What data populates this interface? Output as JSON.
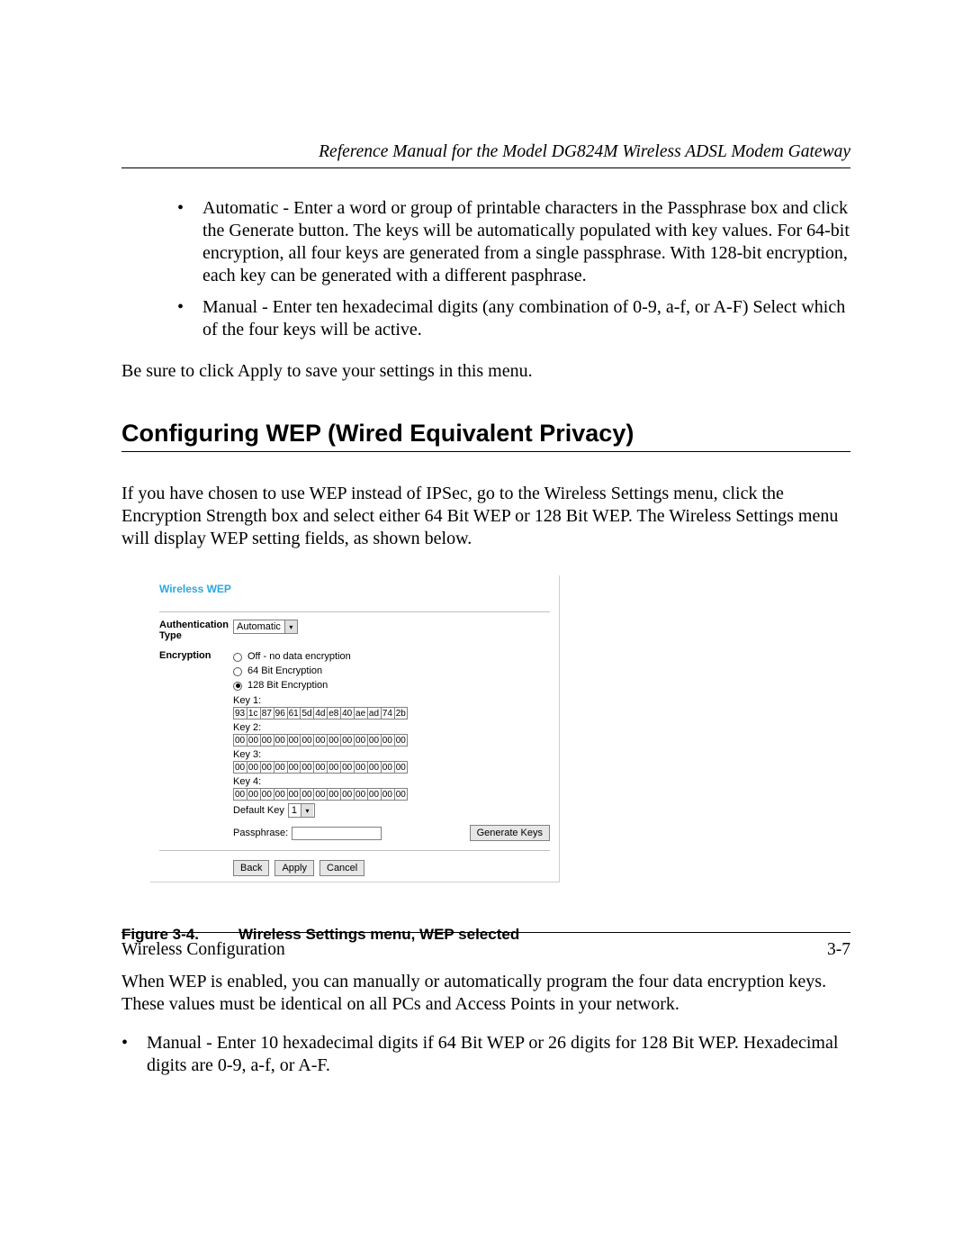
{
  "header": {
    "running_head": "Reference Manual for the Model DG824M Wireless ADSL Modem Gateway"
  },
  "bullets": {
    "automatic": "Automatic - Enter a word or group of printable characters in the Passphrase box and click the Generate button. The keys will be automatically populated with key values. For 64-bit encryption, all four keys are generated from a single passphrase. With 128-bit encryption, each key can be generated with a different pasphrase.",
    "manual_top": "Manual - Enter ten hexadecimal digits (any combination of 0-9, a-f, or A-F) Select which of the four keys will be active."
  },
  "apply_note": "Be sure to click Apply to save your settings in this menu.",
  "section_heading": "Configuring WEP (Wired Equivalent Privacy)",
  "intro_paragraph": "If you have chosen to use WEP instead of IPSec, go to the Wireless Settings menu, click the Encryption Strength box and select either 64 Bit WEP or 128 Bit WEP. The Wireless Settings menu will display WEP setting fields, as shown below.",
  "screenshot": {
    "title": "Wireless WEP",
    "auth_label": "Authentication Type",
    "auth_value": "Automatic",
    "enc_label": "Encryption",
    "enc_options": {
      "off": "Off - no data encryption",
      "e64": "64 Bit Encryption",
      "e128": "128 Bit Encryption"
    },
    "key_labels": {
      "k1": "Key 1:",
      "k2": "Key 2:",
      "k3": "Key 3:",
      "k4": "Key 4:"
    },
    "keys": {
      "k1": [
        "93",
        "1c",
        "87",
        "96",
        "61",
        "5d",
        "4d",
        "e8",
        "40",
        "ae",
        "ad",
        "74",
        "2b"
      ],
      "k2": [
        "00",
        "00",
        "00",
        "00",
        "00",
        "00",
        "00",
        "00",
        "00",
        "00",
        "00",
        "00",
        "00"
      ],
      "k3": [
        "00",
        "00",
        "00",
        "00",
        "00",
        "00",
        "00",
        "00",
        "00",
        "00",
        "00",
        "00",
        "00"
      ],
      "k4": [
        "00",
        "00",
        "00",
        "00",
        "00",
        "00",
        "00",
        "00",
        "00",
        "00",
        "00",
        "00",
        "00"
      ]
    },
    "default_key_label": "Default Key",
    "default_key_value": "1",
    "passphrase_label": "Passphrase:",
    "generate_btn": "Generate Keys",
    "back_btn": "Back",
    "apply_btn": "Apply",
    "cancel_btn": "Cancel"
  },
  "figure_caption": {
    "num": "Figure 3-4.",
    "text": "Wireless Settings menu, WEP selected"
  },
  "after_figure": "When WEP is enabled, you can manually or automatically program the four data encryption keys. These values must be identical on all PCs and Access Points in your network.",
  "lower_bullet": "Manual - Enter 10 hexadecimal digits if 64 Bit WEP or 26 digits for 128 Bit WEP. Hexadecimal digits are 0-9, a-f, or A-F.",
  "footer": {
    "left": "Wireless Configuration",
    "right": "3-7"
  }
}
